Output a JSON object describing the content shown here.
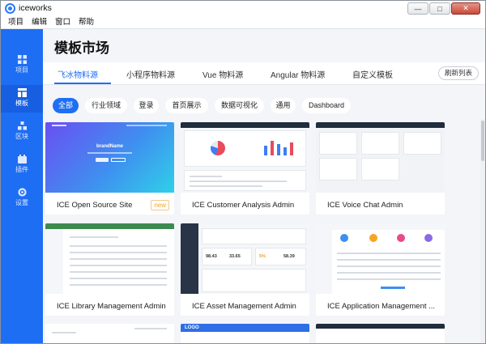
{
  "window": {
    "title": "iceworks"
  },
  "menu": [
    "项目",
    "编辑",
    "窗口",
    "帮助"
  ],
  "sidebar": {
    "items": [
      {
        "label": "项目",
        "icon": "grid-icon",
        "active": false
      },
      {
        "label": "模板",
        "icon": "template-icon",
        "active": true
      },
      {
        "label": "区块",
        "icon": "blocks-icon",
        "active": false
      },
      {
        "label": "插件",
        "icon": "plugin-icon",
        "active": false
      },
      {
        "label": "设置",
        "icon": "gear-icon",
        "active": false
      }
    ]
  },
  "page": {
    "title": "模板市场"
  },
  "tabs": [
    "飞冰物料源",
    "小程序物料源",
    "Vue 物料源",
    "Angular 物料源",
    "自定义模板"
  ],
  "refresh_label": "刷新列表",
  "categories": [
    "全部",
    "行业领域",
    "登录",
    "首页展示",
    "数据可视化",
    "通用",
    "Dashboard"
  ],
  "cards": [
    {
      "name": "ICE Open Source Site",
      "badge": "new",
      "thumb_title": "brandName"
    },
    {
      "name": "ICE Customer Analysis Admin"
    },
    {
      "name": "ICE Voice Chat Admin"
    },
    {
      "name": "ICE Library Management Admin"
    },
    {
      "name": "ICE Asset Management Admin",
      "stats": [
        "98.43",
        "33.65",
        "5%",
        "58.39"
      ]
    },
    {
      "name": "ICE Application Management ..."
    }
  ],
  "partial_cards": [
    {
      "thumb_text": "LOGO"
    }
  ],
  "colors": {
    "primary": "#1f6ff3",
    "sidebar": "#1e6ef4",
    "badge_new": "#f5a623"
  }
}
